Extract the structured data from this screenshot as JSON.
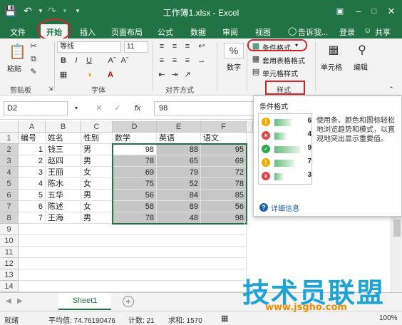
{
  "window": {
    "title": "工作簿1.xlsx - Excel"
  },
  "tabs": [
    "文件",
    "开始",
    "插入",
    "页面布局",
    "公式",
    "数据",
    "审阅",
    "视图"
  ],
  "tab_tell": "告诉我...",
  "tab_login": "登录",
  "tab_share": "共享",
  "ribbon": {
    "paste": "粘贴",
    "font_name": "等线",
    "font_size": "11",
    "font_group": "字体",
    "align_group": "对齐方式",
    "clipboard_group": "剪贴板",
    "number": "数字",
    "percent_icon": "%",
    "cond_format": "条件格式",
    "table_format": "套用表格格式",
    "cell_style": "单元格样式",
    "styles_group": "样式",
    "cells": "单元格",
    "editing": "编辑"
  },
  "formula": {
    "namebox": "D2",
    "fx": "fx",
    "value": "98"
  },
  "sheet": {
    "col_headers": [
      "A",
      "B",
      "C",
      "D",
      "E",
      "F"
    ],
    "row_numbers": [
      "1",
      "2",
      "3",
      "4",
      "5",
      "6",
      "7",
      "8",
      "9",
      "10",
      "11",
      "12",
      "13",
      "14",
      "15"
    ],
    "header_row": [
      "编号",
      "姓名",
      "性别",
      "数学",
      "英语",
      "语文"
    ],
    "rows": [
      [
        "1",
        "钱三",
        "男",
        "98",
        "88",
        "95"
      ],
      [
        "2",
        "赵四",
        "男",
        "78",
        "65",
        "69"
      ],
      [
        "3",
        "王丽",
        "女",
        "69",
        "79",
        "72"
      ],
      [
        "4",
        "陈水",
        "女",
        "75",
        "52",
        "78"
      ],
      [
        "5",
        "五华",
        "男",
        "56",
        "84",
        "85"
      ],
      [
        "6",
        "陈述",
        "女",
        "58",
        "89",
        "56"
      ],
      [
        "7",
        "王海",
        "男",
        "78",
        "48",
        "98"
      ]
    ]
  },
  "popup": {
    "title": "条件格式",
    "description": "使用条、颜色和图标轻松地浏览趋势和模式，以直观地突出显示重要值。",
    "preview": [
      {
        "icon": "!",
        "color": "#f2a900",
        "value": "6",
        "bar": 0.6
      },
      {
        "icon": "×",
        "color": "#e04343",
        "value": "4",
        "bar": 0.4
      },
      {
        "icon": "✓",
        "color": "#2aa84a",
        "value": "9",
        "bar": 0.9
      },
      {
        "icon": "!",
        "color": "#f2a900",
        "value": "7",
        "bar": 0.7
      },
      {
        "icon": "×",
        "color": "#e04343",
        "value": "3",
        "bar": 0.3
      }
    ],
    "more_info": "详细信息"
  },
  "sheet_tab": "Sheet1",
  "status": {
    "ready": "就绪",
    "average": "平均值: 74.76190476",
    "count": "计数: 21",
    "sum": "求和: 1570",
    "zoom": "100%"
  },
  "watermark": {
    "text": "技术员联盟",
    "url": "www.jsgho.com"
  },
  "colors": {
    "excel_green": "#217346",
    "highlight_red": "#d4262a"
  }
}
